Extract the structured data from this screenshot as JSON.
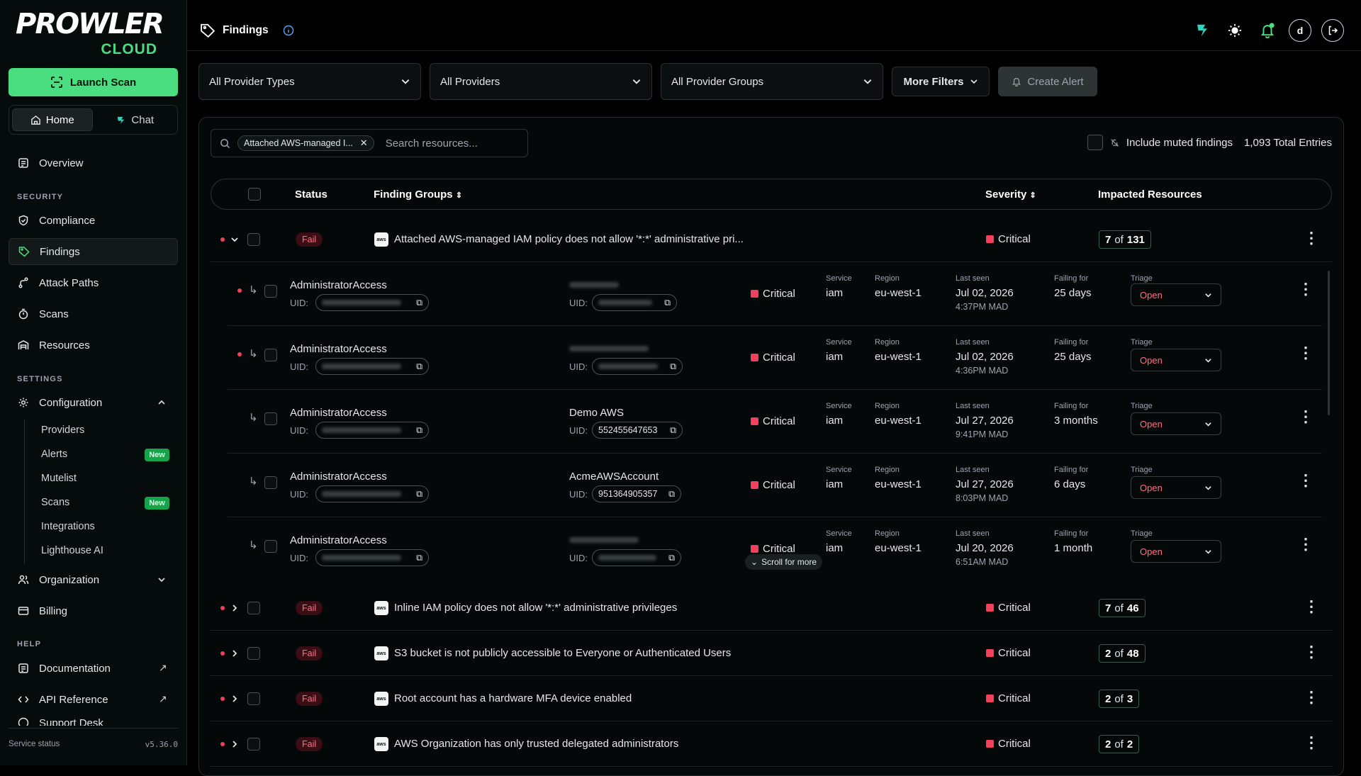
{
  "sidebar": {
    "logo_main": "PROWLER",
    "logo_sub": "CLOUD",
    "launch_label": "Launch Scan",
    "home_label": "Home",
    "chat_label": "Chat",
    "overview": "Overview",
    "security_section": "SECURITY",
    "compliance": "Compliance",
    "findings": "Findings",
    "attack_paths": "Attack Paths",
    "scans": "Scans",
    "resources": "Resources",
    "settings_section": "SETTINGS",
    "configuration": "Configuration",
    "providers": "Providers",
    "alerts": "Alerts",
    "mutelist": "Mutelist",
    "scans_sub": "Scans",
    "integrations": "Integrations",
    "lighthouse": "Lighthouse AI",
    "new_badge": "New",
    "organization": "Organization",
    "billing": "Billing",
    "help_section": "HELP",
    "documentation": "Documentation",
    "api_reference": "API Reference",
    "support_desk": "Support Desk",
    "service_status": "Service status",
    "version": "v5.36.0"
  },
  "header": {
    "title": "Findings",
    "avatar_letter": "d"
  },
  "filters": {
    "provider_types": "All Provider Types",
    "providers": "All Providers",
    "provider_groups": "All Provider Groups",
    "more_filters": "More Filters",
    "create_alert": "Create Alert"
  },
  "search": {
    "chip": "Attached AWS-managed I...",
    "placeholder": "Search resources...",
    "include_muted": "Include muted findings",
    "total": "1,093 Total Entries"
  },
  "columns": {
    "status": "Status",
    "finding_groups": "Finding Groups",
    "severity": "Severity",
    "impacted": "Impacted Resources"
  },
  "groups": [
    {
      "status": "Fail",
      "title": "Attached AWS-managed IAM policy does not allow '*:*' administrative pri...",
      "severity": "Critical",
      "impacted_count": "7",
      "impacted_of": "of",
      "impacted_total": "131"
    },
    {
      "status": "Fail",
      "title": "Inline IAM policy does not allow '*:*' administrative privileges",
      "severity": "Critical",
      "impacted_count": "7",
      "impacted_of": "of",
      "impacted_total": "46"
    },
    {
      "status": "Fail",
      "title": "S3 bucket is not publicly accessible to Everyone or Authenticated Users",
      "severity": "Critical",
      "impacted_count": "2",
      "impacted_of": "of",
      "impacted_total": "48"
    },
    {
      "status": "Fail",
      "title": "Root account has a hardware MFA device enabled",
      "severity": "Critical",
      "impacted_count": "2",
      "impacted_of": "of",
      "impacted_total": "3"
    },
    {
      "status": "Fail",
      "title": "AWS Organization has only trusted delegated administrators",
      "severity": "Critical",
      "impacted_count": "2",
      "impacted_of": "of",
      "impacted_total": "2"
    }
  ],
  "sub_labels": {
    "uid": "UID:",
    "service": "Service",
    "region": "Region",
    "last_seen": "Last seen",
    "failing_for": "Failing for",
    "triage": "Triage"
  },
  "resources": [
    {
      "name": "AdministratorAccess",
      "account": "",
      "account_uid": "",
      "severity": "Critical",
      "service": "iam",
      "region": "eu-west-1",
      "date": "Jul 02, 2026",
      "time": "4:37PM MAD",
      "failing": "25 days",
      "triage": "Open"
    },
    {
      "name": "AdministratorAccess",
      "account": "",
      "account_uid": "",
      "severity": "Critical",
      "service": "iam",
      "region": "eu-west-1",
      "date": "Jul 02, 2026",
      "time": "4:36PM MAD",
      "failing": "25 days",
      "triage": "Open"
    },
    {
      "name": "AdministratorAccess",
      "account": "Demo AWS",
      "account_uid": "552455647653",
      "severity": "Critical",
      "service": "iam",
      "region": "eu-west-1",
      "date": "Jul 27, 2026",
      "time": "9:41PM MAD",
      "failing": "3 months",
      "triage": "Open"
    },
    {
      "name": "AdministratorAccess",
      "account": "AcmeAWSAccount",
      "account_uid": "951364905357",
      "severity": "Critical",
      "service": "iam",
      "region": "eu-west-1",
      "date": "Jul 27, 2026",
      "time": "8:03PM MAD",
      "failing": "6 days",
      "triage": "Open"
    },
    {
      "name": "AdministratorAccess",
      "account": "",
      "account_uid": "",
      "severity": "Critical",
      "service": "iam",
      "region": "eu-west-1",
      "date": "Jul 20, 2026",
      "time": "6:51AM MAD",
      "failing": "1 month",
      "triage": "Open"
    }
  ],
  "scroll_more": "Scroll for more"
}
